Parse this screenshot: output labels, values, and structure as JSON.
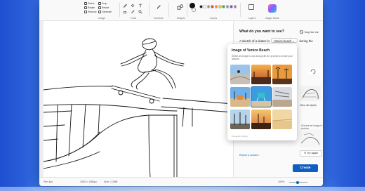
{
  "toolbar": {
    "groups": [
      {
        "id": "image",
        "label": "Image"
      },
      {
        "id": "tools",
        "label": "Tools"
      },
      {
        "id": "brushes",
        "label": "Brushes"
      },
      {
        "id": "shapes",
        "label": "Shapes"
      },
      {
        "id": "colors",
        "label": "Colors"
      },
      {
        "id": "layers",
        "label": "Layers"
      },
      {
        "id": "magic_mode",
        "label": "Magic Mode"
      }
    ],
    "image_buttons": [
      "Select",
      "Crop",
      "Rotate",
      "Resize",
      "Remove",
      "Generate"
    ],
    "colors": {
      "primary": "#111111",
      "secondary": "#ffffff",
      "palette": [
        "#111111",
        "#ffffff",
        "#8a8a8a",
        "#e23a3a",
        "#f08a24",
        "#f3d21f",
        "#2fb34a",
        "#2a9dd8",
        "#6a4bd6",
        "#c83ad0"
      ]
    }
  },
  "cocreator": {
    "title": "What do you want to see?",
    "surprise_label": "Surprise me",
    "prompt_prefix": "A sketch of a skater in",
    "prompt_chip": "Venice beach",
    "prompt_suffix": "during the",
    "view_all_label": "View all styles",
    "explore_label": "Choose an image to explore",
    "try_again_label": "Try again",
    "report_label": "Report a concern",
    "create_label": "Create"
  },
  "popup": {
    "title": "Image of Venice Beach",
    "subtitle": "Select an image to use along with the prompt to create your artwork",
    "footer": "Powered by Bing",
    "images": [
      {
        "name": "skate-park-photo"
      },
      {
        "name": "pier-sunset-photo"
      },
      {
        "name": "palm-street-photo"
      },
      {
        "name": "lifeguard-tower-photo",
        "selected": true
      },
      {
        "name": "palm-silhouette-photo"
      },
      {
        "name": "beach-sunset-photo"
      }
    ]
  },
  "statusbar": {
    "tool": "Pen 4px",
    "dimensions": "1920 × 1080px",
    "size": "Size: 1.2MB",
    "zoom": "100%"
  },
  "icons": {
    "surprise": "dice-icon",
    "refresh": "refresh-icon",
    "panel_close": "close-icon"
  }
}
